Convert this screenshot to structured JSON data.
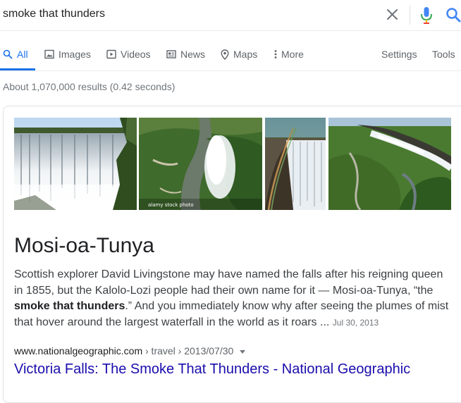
{
  "search": {
    "query": "smoke that thunders"
  },
  "tabs": {
    "items": [
      {
        "label": "All",
        "icon": "search-icon"
      },
      {
        "label": "Images",
        "icon": "image-icon"
      },
      {
        "label": "Videos",
        "icon": "play-icon"
      },
      {
        "label": "News",
        "icon": "news-icon"
      },
      {
        "label": "Maps",
        "icon": "map-pin-icon"
      },
      {
        "label": "More",
        "icon": "vertical-dots-icon"
      }
    ],
    "active": "All",
    "settings": "Settings",
    "tools": "Tools"
  },
  "stats": "About 1,070,000 results (0.42 seconds)",
  "featured": {
    "images": [
      {
        "name": "waterfall-image-1"
      },
      {
        "name": "waterfall-image-2",
        "watermark": "alamy stock photo"
      },
      {
        "name": "waterfall-image-3"
      },
      {
        "name": "waterfall-image-4"
      }
    ],
    "entity": "Mosi-oa-Tunya",
    "snippet_part1": "Scottish explorer David Livingstone may have named the falls after his reigning queen in 1855, but the Kalolo-Lozi people had their own name for it — Mosi-oa-Tunya, “the ",
    "snippet_bold": "smoke that thunders",
    "snippet_part2": ".” And you immediately know why after seeing the plumes of mist that hover around the largest waterfall in the world as it roars ...",
    "date": "Jul 30, 2013",
    "cite_domain": "www.nationalgeographic.com",
    "cite_path": " › travel › 2013/07/30",
    "title": "Victoria Falls: The Smoke That Thunders - National Geographic"
  },
  "colors": {
    "link": "#1a0dab",
    "accent": "#1a73e8",
    "muted": "#70757a"
  }
}
